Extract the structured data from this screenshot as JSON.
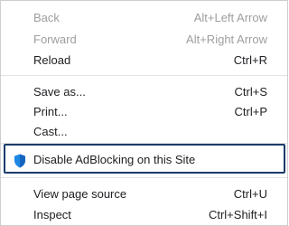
{
  "menu": {
    "back": {
      "label": "Back",
      "shortcut": "Alt+Left Arrow"
    },
    "forward": {
      "label": "Forward",
      "shortcut": "Alt+Right Arrow"
    },
    "reload": {
      "label": "Reload",
      "shortcut": "Ctrl+R"
    },
    "save_as": {
      "label": "Save as...",
      "shortcut": "Ctrl+S"
    },
    "print": {
      "label": "Print...",
      "shortcut": "Ctrl+P"
    },
    "cast": {
      "label": "Cast..."
    },
    "adblock": {
      "label": "Disable AdBlocking on this Site",
      "icon": "shield-icon"
    },
    "view_source": {
      "label": "View page source",
      "shortcut": "Ctrl+U"
    },
    "inspect": {
      "label": "Inspect",
      "shortcut": "Ctrl+Shift+I"
    }
  },
  "colors": {
    "disabled_text": "#9e9e9e",
    "text": "#202124",
    "highlight_border": "#1a3c6b",
    "shield": "#1e88e5"
  }
}
